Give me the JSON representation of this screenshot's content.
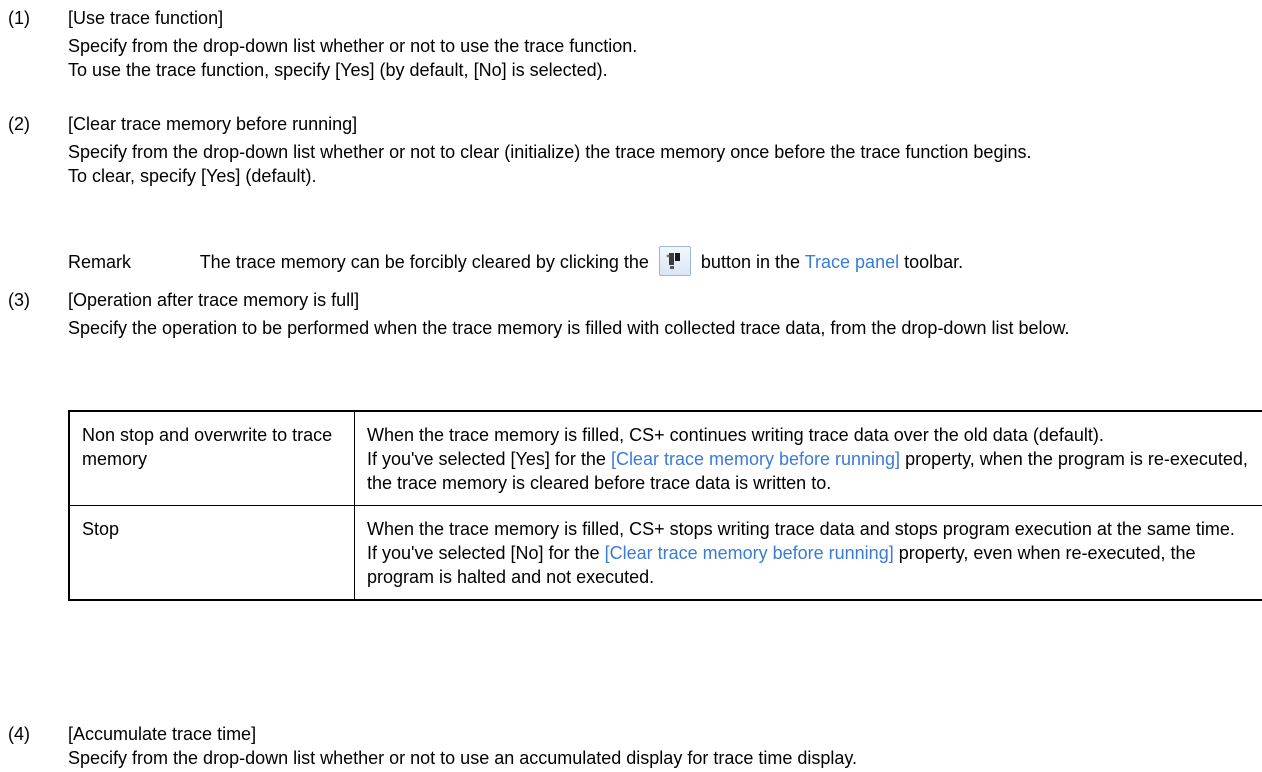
{
  "items": [
    {
      "num": "(1)",
      "heading": "[Use trace function]",
      "lines": [
        "Specify from the drop-down list whether or not to use the trace function.",
        "To use the trace function, specify [Yes] (by default, [No] is selected)."
      ]
    },
    {
      "num": "(2)",
      "heading": "[Clear trace memory before running]",
      "lines": [
        "Specify from the drop-down list whether or not to clear (initialize) the trace memory once before the trace function begins.",
        "To clear, specify [Yes] (default)."
      ],
      "remark": {
        "label": "Remark",
        "text_before": "The trace memory can be forcibly cleared by clicking the",
        "icon": "clear-trace-icon",
        "text_middle": "button in the",
        "link": "Trace panel",
        "text_after": "toolbar."
      }
    },
    {
      "num": "(3)",
      "heading": "[Operation after trace memory is full]",
      "lines": [
        "Specify the operation to be performed when the trace memory is filled with collected trace data, from the drop-down list below."
      ]
    },
    {
      "num": "(4)",
      "heading": "[Accumulate trace time]",
      "lines": [
        "Specify from the drop-down list whether or not to use an accumulated display for trace time display."
      ]
    }
  ],
  "table": {
    "rows": [
      {
        "option": "Non stop and overwrite to trace memory",
        "desc1": "When the trace memory is filled, CS+ continues writing trace data over the old data (default).",
        "desc2_before": "If you've selected [Yes] for the",
        "desc2_link": "[Clear trace memory before running]",
        "desc2_after": "property, when the program is re-executed, the trace memory is cleared before trace data is written to."
      },
      {
        "option": "Stop",
        "desc1": "When the trace memory is filled, CS+ stops writing trace data and stops program execution at the same time.",
        "desc2_before": "If you've selected [No] for the",
        "desc2_link": "[Clear trace memory before running]",
        "desc2_after": "property, even when re-executed, the program is halted and not executed."
      }
    ]
  },
  "colors": {
    "link": "#3a7bd5"
  }
}
